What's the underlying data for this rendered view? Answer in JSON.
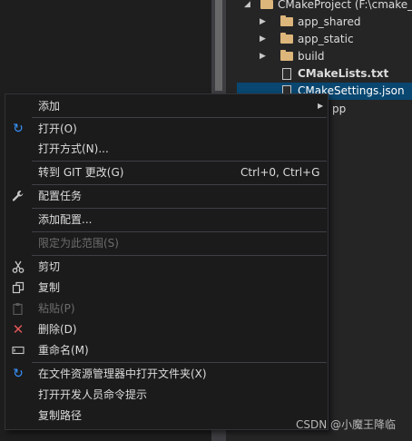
{
  "tree": {
    "root_label": "CMakeProject (F:\\cmake_",
    "items": [
      {
        "label": "app_shared"
      },
      {
        "label": "app_static"
      },
      {
        "label": "build"
      },
      {
        "label": "CMakeLists.txt"
      },
      {
        "label": "CMakeSettings.json"
      },
      {
        "label": "pp"
      }
    ]
  },
  "menu": {
    "add": "添加",
    "open": "打开(O)",
    "open_with": "打开方式(N)...",
    "goto_git": "转到 GIT 更改(G)",
    "goto_git_shortcut": "Ctrl+0, Ctrl+G",
    "config_task": "配置任务",
    "add_config": "添加配置...",
    "limit_scope": "限定为此范围(S)",
    "cut": "剪切",
    "copy": "复制",
    "paste": "粘贴(P)",
    "delete": "删除(D)",
    "rename": "重命名(M)",
    "open_in_explorer": "在文件资源管理器中打开文件夹(X)",
    "open_dev_cmd": "打开开发人员命令提示",
    "copy_path": "复制路径"
  },
  "watermark": "CSDN @小魔王降临",
  "colors": {
    "selection": "#094771",
    "folder": "#dcb67a",
    "refresh_blue": "#3794ff",
    "delete_red": "#e15656"
  }
}
